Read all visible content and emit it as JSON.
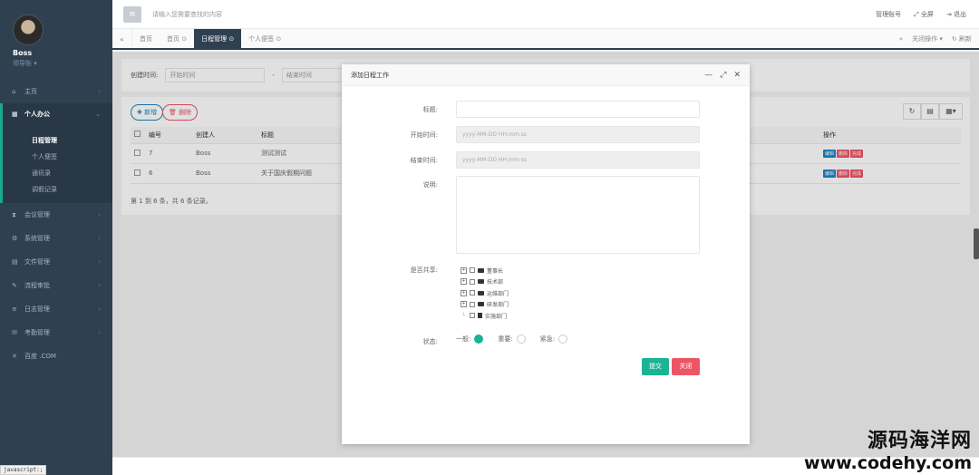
{
  "sidebar": {
    "user_name": "Boss",
    "user_role": "领导账 ▾",
    "items": [
      {
        "label": "主页",
        "icon": "home-icon"
      },
      {
        "label": "个人办公",
        "icon": "calendar-icon",
        "active": true
      },
      {
        "label": "会议管理",
        "icon": "hourglass-icon"
      },
      {
        "label": "系统管理",
        "icon": "gear-icon"
      },
      {
        "label": "文件管理",
        "icon": "file-icon"
      },
      {
        "label": "流程审批",
        "icon": "wrench-icon"
      },
      {
        "label": "日志管理",
        "icon": "log-icon"
      },
      {
        "label": "考勤管理",
        "icon": "chat-icon"
      },
      {
        "label": "百度 .COM",
        "icon": "close-icon"
      }
    ],
    "sub_items": [
      "日程管理",
      "个人便签",
      "通讯录",
      "调假记录"
    ],
    "js_status": "javascript:;"
  },
  "topbar": {
    "search_placeholder": "请输入您需要查找的内容",
    "right_items": [
      "管理账号",
      "全屏",
      "退出"
    ]
  },
  "tabs": {
    "items": [
      "首页",
      "首页 ⊙",
      "日程管理 ⊙",
      "个人便签 ⊙"
    ],
    "active_index": 2,
    "right_items": [
      "关闭操作 ▾",
      "刷新"
    ]
  },
  "filter": {
    "label": "创建时间:",
    "start_placeholder": "开始时间",
    "separator": "-",
    "end_placeholder": "结束时间"
  },
  "table": {
    "add_label": "新增",
    "delete_label": "删除",
    "columns": [
      "编号",
      "创建人",
      "标题",
      "操作"
    ],
    "rows": [
      {
        "id": "7",
        "creator": "Boss",
        "title": "测试测试"
      },
      {
        "id": "6",
        "creator": "Boss",
        "title": "关于国庆假期问题"
      }
    ],
    "op_labels": [
      "编辑",
      "删除",
      "完成"
    ],
    "pager": "第 1 到 6 条，共 6 条记录。"
  },
  "modal": {
    "title": "添加日程工作",
    "labels": {
      "title": "标题:",
      "start_time": "开始时间:",
      "end_time": "结束时间:",
      "description": "说明:",
      "share": "是否共享:",
      "status": "状态:"
    },
    "start_placeholder": "yyyy-MM-DD HH:mm:ss",
    "end_placeholder": "yyyy-MM-DD HH:mm:ss",
    "tree": [
      {
        "label": "董事长",
        "type": "folder"
      },
      {
        "label": "技术部",
        "type": "folder"
      },
      {
        "label": "运维部门",
        "type": "folder"
      },
      {
        "label": "研发部门",
        "type": "folder"
      },
      {
        "label": "实施部门",
        "type": "file"
      }
    ],
    "status_options": [
      {
        "label": "一般:",
        "checked": true
      },
      {
        "label": "重要:",
        "checked": false
      },
      {
        "label": "紧急:",
        "checked": false
      }
    ],
    "submit_label": "提交",
    "close_label": "关闭"
  },
  "watermark": {
    "cn": "源码海洋网",
    "url": "www.codehy.com"
  },
  "colors": {
    "sidebar_bg": "#2f4050",
    "primary": "#1ab394",
    "danger": "#ed5565",
    "info": "#1c84c6"
  }
}
